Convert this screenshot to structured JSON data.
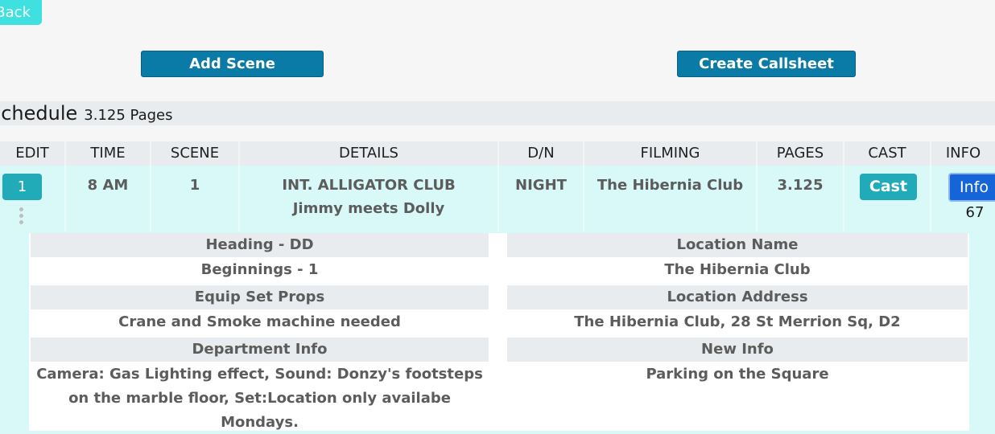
{
  "nav": {
    "back_label": "Back"
  },
  "toolbar": {
    "add_scene_label": "Add Scene",
    "create_callsheet_label": "Create Callsheet"
  },
  "schedule": {
    "title": "Schedule",
    "pages_label": "3.125 Pages"
  },
  "columns": [
    "EDIT",
    "TIME",
    "SCENE",
    "DETAILS",
    "D/N",
    "FILMING",
    "PAGES",
    "CAST",
    "INFO"
  ],
  "row": {
    "edit_number": "1",
    "time": "8 AM",
    "scene": "1",
    "details_heading": "INT. ALLIGATOR CLUB",
    "details_synopsis": "Jimmy meets Dolly",
    "day_night": "NIGHT",
    "filming": "The Hibernia Club",
    "pages": "3.125",
    "cast_button": "Cast",
    "info_button": "Info",
    "info_count": "67"
  },
  "details": {
    "heading_label": "Heading - DD",
    "heading_value": "Beginnings - 1",
    "equip_label": "Equip Set Props",
    "equip_value": "Crane and Smoke machine needed",
    "dept_label": "Department Info",
    "dept_value": "Camera: Gas Lighting effect, Sound: Donzy's footsteps on the marble floor, Set:Location only availabe Mondays.",
    "location_name_label": "Location Name",
    "location_name_value": "The Hibernia Club",
    "location_address_label": "Location Address",
    "location_address_value": "The Hibernia Club, 28 St Merrion Sq, D2",
    "new_info_label": "New Info",
    "new_info_value": "Parking on the Square"
  },
  "colors": {
    "accent": "#0a7aa6",
    "teal": "#21aab8",
    "info_blue": "#1565d8",
    "row_bg": "#d9f8f8",
    "back": "#3fe0e0"
  }
}
